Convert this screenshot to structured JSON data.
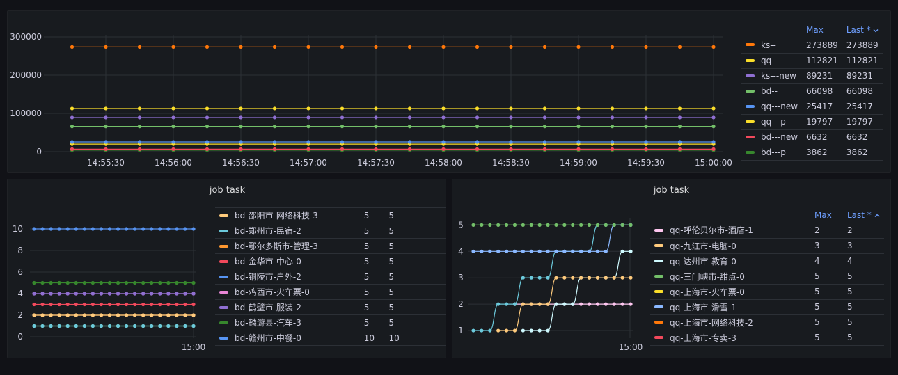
{
  "top_panel": {
    "legend_headers": {
      "max": "Max",
      "last": "Last *",
      "sort_icon": "chevron-down-icon"
    },
    "legend": [
      {
        "name": "ks--",
        "color": "#ff780a",
        "max": "273889",
        "last": "273889"
      },
      {
        "name": "qq--",
        "color": "#fade2a",
        "max": "112821",
        "last": "112821"
      },
      {
        "name": "ks---new",
        "color": "#8f6fd2",
        "max": "89231",
        "last": "89231"
      },
      {
        "name": "bd--",
        "color": "#73bf69",
        "max": "66098",
        "last": "66098"
      },
      {
        "name": "qq---new",
        "color": "#5794f2",
        "max": "25417",
        "last": "25417"
      },
      {
        "name": "qq---p",
        "color": "#fade2a",
        "max": "19797",
        "last": "19797"
      },
      {
        "name": "bd---new",
        "color": "#f2495c",
        "max": "6632",
        "last": "6632"
      },
      {
        "name": "bd---p",
        "color": "#37872d",
        "max": "3862",
        "last": "3862"
      }
    ]
  },
  "left_panel": {
    "title": "job task",
    "legend": [
      {
        "name": "bd-邵阳市-网络科技-3",
        "color": "#ffcb7d",
        "max": "5",
        "last": "5"
      },
      {
        "name": "bd-郑州市-民宿-2",
        "color": "#6ccadc",
        "max": "5",
        "last": "5"
      },
      {
        "name": "bd-鄂尔多斯市-管理-3",
        "color": "#ff9830",
        "max": "5",
        "last": "5"
      },
      {
        "name": "bd-金华市-中心-0",
        "color": "#f2495c",
        "max": "5",
        "last": "5"
      },
      {
        "name": "bd-铜陵市-户外-2",
        "color": "#5794f2",
        "max": "5",
        "last": "5"
      },
      {
        "name": "bd-鸡西市-火车票-0",
        "color": "#e885d6",
        "max": "5",
        "last": "5"
      },
      {
        "name": "bd-鹤壁市-服装-2",
        "color": "#8f6fd2",
        "max": "5",
        "last": "5"
      },
      {
        "name": "bd-麟游县-汽车-3",
        "color": "#37872d",
        "max": "5",
        "last": "5"
      },
      {
        "name": "bd-赣州市-中餐-0",
        "color": "#5794f2",
        "max": "10",
        "last": "10"
      }
    ]
  },
  "right_panel": {
    "title": "job task",
    "legend_headers": {
      "max": "Max",
      "last": "Last *",
      "sort_icon": "chevron-up-icon"
    },
    "legend": [
      {
        "name": "qq-呼伦贝尔市-酒店-1",
        "color": "#ffc7f0",
        "max": "2",
        "last": "2"
      },
      {
        "name": "qq-九江市-电脑-0",
        "color": "#ffcb7d",
        "max": "3",
        "last": "3"
      },
      {
        "name": "qq-达州市-教育-0",
        "color": "#cffaff",
        "max": "4",
        "last": "4"
      },
      {
        "name": "qq-三门峡市-甜点-0",
        "color": "#73bf69",
        "max": "5",
        "last": "5"
      },
      {
        "name": "qq-上海市-火车票-0",
        "color": "#fade2a",
        "max": "5",
        "last": "5"
      },
      {
        "name": "qq-上海市-滑雪-1",
        "color": "#8ab8ff",
        "max": "5",
        "last": "5"
      },
      {
        "name": "qq-上海市-网络科技-2",
        "color": "#ff780a",
        "max": "5",
        "last": "5"
      },
      {
        "name": "qq-上海市-专卖-3",
        "color": "#f2495c",
        "max": "5",
        "last": "5"
      }
    ]
  },
  "chart_data": [
    {
      "type": "line",
      "x": [
        "14:55:30",
        "14:56:00",
        "14:56:30",
        "14:57:00",
        "14:57:30",
        "14:58:00",
        "14:58:30",
        "14:59:00",
        "14:59:30",
        "15:00:00"
      ],
      "points_per_series": 20,
      "ylim": [
        0,
        300000
      ],
      "yticks": [
        "0",
        "100000",
        "200000",
        "300000"
      ],
      "grid": true,
      "legend_position": "right",
      "series": [
        {
          "name": "ks--",
          "color": "#ff780a",
          "value": 273889
        },
        {
          "name": "qq--",
          "color": "#fade2a",
          "value": 112821
        },
        {
          "name": "ks---new",
          "color": "#8f6fd2",
          "value": 89231
        },
        {
          "name": "bd--",
          "color": "#73bf69",
          "value": 66098
        },
        {
          "name": "qq---new",
          "color": "#5794f2",
          "value": 25417
        },
        {
          "name": "qq---p",
          "color": "#fade2a",
          "value": 19797
        },
        {
          "name": "bd---new",
          "color": "#f2495c",
          "value": 6632
        },
        {
          "name": "bd---p",
          "color": "#37872d",
          "value": 3862
        }
      ]
    },
    {
      "type": "line",
      "title": "job task",
      "x_last_tick": "15:00",
      "points_per_series": 20,
      "ylim": [
        0,
        10
      ],
      "yticks": [
        "0",
        "2",
        "4",
        "6",
        "8",
        "10"
      ],
      "grid": true,
      "legend_position": "right",
      "series": [
        {
          "name": "bd-赣州市-中餐-0",
          "color": "#5794f2",
          "value": 10
        },
        {
          "name": "bd-麟游县-汽车-3",
          "color": "#37872d",
          "value": 5
        },
        {
          "name": "bd-鹤壁市-服装-2",
          "color": "#8f6fd2",
          "value": 4
        },
        {
          "name": "bd-鸡西市-火车票-0",
          "color": "#e885d6",
          "value": 4
        },
        {
          "name": "bd-金华市-中心-0",
          "color": "#f2495c",
          "value": 3
        },
        {
          "name": "bd-邵阳市-网络科技-3",
          "color": "#ffcb7d",
          "value": 2
        },
        {
          "name": "bd-鄂尔多斯市-管理-3",
          "color": "#ff9830",
          "value": 2
        },
        {
          "name": "bd-郑州市-民宿-2",
          "color": "#6ccadc",
          "value": 1
        },
        {
          "name": "bd-铜陵市-户外-2",
          "color": "#73bf69",
          "value": 1
        }
      ]
    },
    {
      "type": "line",
      "title": "job task",
      "x_last_tick": "15:00",
      "ylim": [
        0.5,
        5.3
      ],
      "yticks": [
        "1",
        "2",
        "3",
        "4",
        "5"
      ],
      "grid": true,
      "legend_position": "right",
      "series": [
        {
          "name": "qq-三门峡市-甜点-0",
          "color": "#73bf69",
          "values": [
            5,
            5,
            5,
            5,
            5,
            5,
            5,
            5,
            5,
            5,
            5,
            5,
            5,
            5,
            5,
            5,
            5,
            5,
            5,
            5
          ]
        },
        {
          "name": "qq-上海市-滑雪-1",
          "color": "#8ab8ff",
          "values": [
            4,
            4,
            4,
            4,
            4,
            4,
            4,
            4,
            4,
            4,
            4,
            4,
            4,
            4,
            4,
            4,
            4,
            5,
            5,
            5
          ]
        },
        {
          "name": "qq-上海市-网络科技-2",
          "color": "#6ccadc",
          "values": [
            1,
            1,
            1,
            2,
            2,
            2,
            3,
            3,
            3,
            3,
            4,
            4,
            4,
            4,
            4,
            5,
            5,
            5,
            5,
            5
          ]
        },
        {
          "name": "qq-九江市-电脑-0",
          "color": "#ffcb7d",
          "values": [
            null,
            null,
            null,
            1,
            1,
            1,
            2,
            2,
            2,
            2,
            3,
            3,
            3,
            3,
            3,
            3,
            3,
            3,
            3,
            3
          ]
        },
        {
          "name": "qq-达州市-教育-0",
          "color": "#cffaff",
          "values": [
            null,
            null,
            null,
            null,
            null,
            null,
            1,
            1,
            1,
            1,
            2,
            2,
            2,
            3,
            3,
            3,
            3,
            3,
            4,
            4
          ]
        },
        {
          "name": "qq-呼伦贝尔市-酒店-1",
          "color": "#ffc7f0",
          "values": [
            null,
            null,
            null,
            null,
            null,
            2,
            2,
            2,
            2,
            2,
            2,
            2,
            2,
            2,
            2,
            2,
            2,
            2,
            2,
            2
          ]
        }
      ]
    }
  ]
}
